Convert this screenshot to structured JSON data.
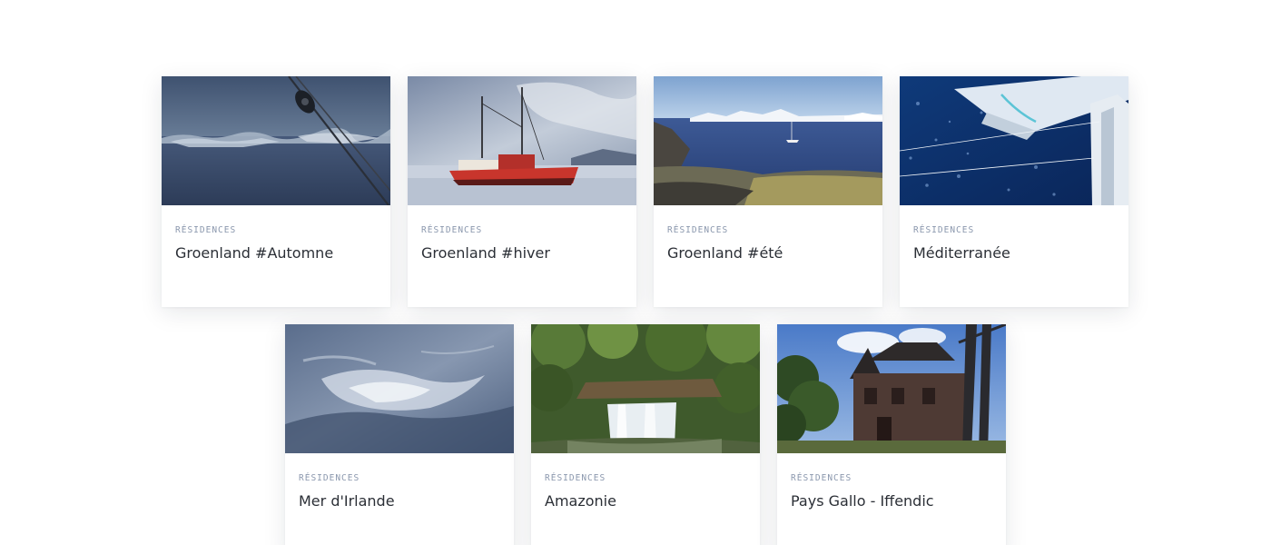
{
  "cards": [
    {
      "category": "Résidences",
      "title": "Groenland #Automne",
      "image": "ice-floes-rigging-photo"
    },
    {
      "category": "Résidences",
      "title": "Groenland #hiver",
      "image": "red-boat-on-ice-photo"
    },
    {
      "category": "Résidences",
      "title": "Groenland #été",
      "image": "fjord-icebergs-sailboat-photo"
    },
    {
      "category": "Résidences",
      "title": "Méditerranée",
      "image": "catamaran-sea-photo"
    },
    {
      "category": "Résidences",
      "title": "Mer d'Irlande",
      "image": "sea-spray-photo"
    },
    {
      "category": "Résidences",
      "title": "Amazonie",
      "image": "waterfall-forest-photo"
    },
    {
      "category": "Résidences",
      "title": "Pays Gallo - Iffendic",
      "image": "stone-manor-photo"
    }
  ],
  "colors": {
    "category": "#8a97ad",
    "title": "#2b2f36",
    "card_background": "#ffffff"
  }
}
